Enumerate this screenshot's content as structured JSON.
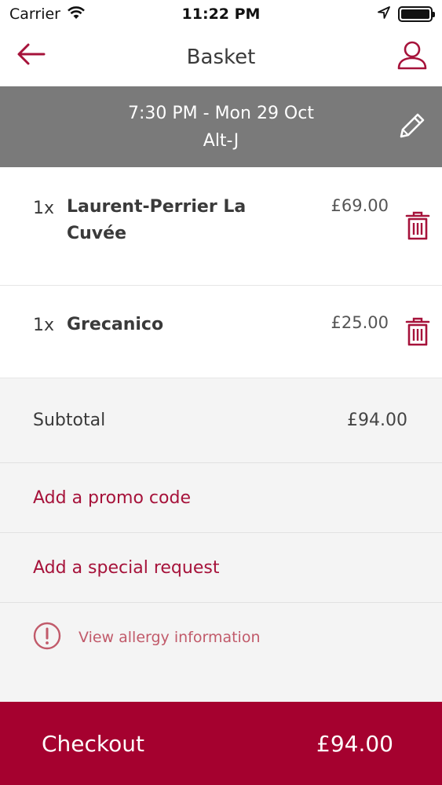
{
  "status_bar": {
    "carrier": "Carrier",
    "time": "11:22 PM",
    "icons": [
      "wifi-icon",
      "location-arrow-icon",
      "battery-icon"
    ]
  },
  "nav": {
    "title": "Basket",
    "back_icon": "arrow-left-icon",
    "profile_icon": "user-icon"
  },
  "booking": {
    "datetime": "7:30 PM - Mon 29 Oct",
    "event": "Alt-J",
    "edit_icon": "pencil-icon"
  },
  "items": [
    {
      "qty": "1x",
      "name": "Laurent-Perrier La Cuvée",
      "price": "£69.00"
    },
    {
      "qty": "1x",
      "name": "Grecanico",
      "price": "£25.00"
    }
  ],
  "summary": {
    "subtotal_label": "Subtotal",
    "subtotal_value": "£94.00",
    "promo_label": "Add a promo code",
    "request_label": "Add a special request",
    "allergy_label": "View allergy information"
  },
  "checkout": {
    "label": "Checkout",
    "total": "£94.00"
  },
  "colors": {
    "accent": "#a5012f",
    "banner": "#7a7a7a",
    "background_grey": "#f4f4f4"
  }
}
